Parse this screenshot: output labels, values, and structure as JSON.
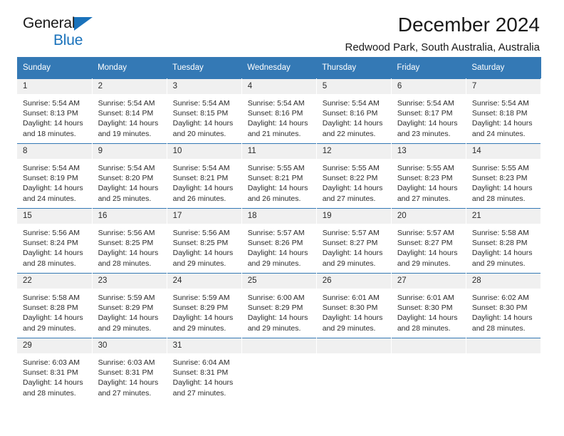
{
  "brand": {
    "word1": "General",
    "word2": "Blue",
    "triangle_color": "#1a72bb",
    "text_color": "#1a1a1a"
  },
  "header": {
    "title": "December 2024",
    "subtitle": "Redwood Park, South Australia, Australia"
  },
  "theme": {
    "header_blue": "#3479b5",
    "daynum_band": "#f0f0f0",
    "text": "#2b2b2b"
  },
  "weekday_headers": [
    "Sunday",
    "Monday",
    "Tuesday",
    "Wednesday",
    "Thursday",
    "Friday",
    "Saturday"
  ],
  "weeks": [
    [
      {
        "day": "1",
        "sunrise": "Sunrise: 5:54 AM",
        "sunset": "Sunset: 8:13 PM",
        "daylight_1": "Daylight: 14 hours",
        "daylight_2": "and 18 minutes."
      },
      {
        "day": "2",
        "sunrise": "Sunrise: 5:54 AM",
        "sunset": "Sunset: 8:14 PM",
        "daylight_1": "Daylight: 14 hours",
        "daylight_2": "and 19 minutes."
      },
      {
        "day": "3",
        "sunrise": "Sunrise: 5:54 AM",
        "sunset": "Sunset: 8:15 PM",
        "daylight_1": "Daylight: 14 hours",
        "daylight_2": "and 20 minutes."
      },
      {
        "day": "4",
        "sunrise": "Sunrise: 5:54 AM",
        "sunset": "Sunset: 8:16 PM",
        "daylight_1": "Daylight: 14 hours",
        "daylight_2": "and 21 minutes."
      },
      {
        "day": "5",
        "sunrise": "Sunrise: 5:54 AM",
        "sunset": "Sunset: 8:16 PM",
        "daylight_1": "Daylight: 14 hours",
        "daylight_2": "and 22 minutes."
      },
      {
        "day": "6",
        "sunrise": "Sunrise: 5:54 AM",
        "sunset": "Sunset: 8:17 PM",
        "daylight_1": "Daylight: 14 hours",
        "daylight_2": "and 23 minutes."
      },
      {
        "day": "7",
        "sunrise": "Sunrise: 5:54 AM",
        "sunset": "Sunset: 8:18 PM",
        "daylight_1": "Daylight: 14 hours",
        "daylight_2": "and 24 minutes."
      }
    ],
    [
      {
        "day": "8",
        "sunrise": "Sunrise: 5:54 AM",
        "sunset": "Sunset: 8:19 PM",
        "daylight_1": "Daylight: 14 hours",
        "daylight_2": "and 24 minutes."
      },
      {
        "day": "9",
        "sunrise": "Sunrise: 5:54 AM",
        "sunset": "Sunset: 8:20 PM",
        "daylight_1": "Daylight: 14 hours",
        "daylight_2": "and 25 minutes."
      },
      {
        "day": "10",
        "sunrise": "Sunrise: 5:54 AM",
        "sunset": "Sunset: 8:21 PM",
        "daylight_1": "Daylight: 14 hours",
        "daylight_2": "and 26 minutes."
      },
      {
        "day": "11",
        "sunrise": "Sunrise: 5:55 AM",
        "sunset": "Sunset: 8:21 PM",
        "daylight_1": "Daylight: 14 hours",
        "daylight_2": "and 26 minutes."
      },
      {
        "day": "12",
        "sunrise": "Sunrise: 5:55 AM",
        "sunset": "Sunset: 8:22 PM",
        "daylight_1": "Daylight: 14 hours",
        "daylight_2": "and 27 minutes."
      },
      {
        "day": "13",
        "sunrise": "Sunrise: 5:55 AM",
        "sunset": "Sunset: 8:23 PM",
        "daylight_1": "Daylight: 14 hours",
        "daylight_2": "and 27 minutes."
      },
      {
        "day": "14",
        "sunrise": "Sunrise: 5:55 AM",
        "sunset": "Sunset: 8:23 PM",
        "daylight_1": "Daylight: 14 hours",
        "daylight_2": "and 28 minutes."
      }
    ],
    [
      {
        "day": "15",
        "sunrise": "Sunrise: 5:56 AM",
        "sunset": "Sunset: 8:24 PM",
        "daylight_1": "Daylight: 14 hours",
        "daylight_2": "and 28 minutes."
      },
      {
        "day": "16",
        "sunrise": "Sunrise: 5:56 AM",
        "sunset": "Sunset: 8:25 PM",
        "daylight_1": "Daylight: 14 hours",
        "daylight_2": "and 28 minutes."
      },
      {
        "day": "17",
        "sunrise": "Sunrise: 5:56 AM",
        "sunset": "Sunset: 8:25 PM",
        "daylight_1": "Daylight: 14 hours",
        "daylight_2": "and 29 minutes."
      },
      {
        "day": "18",
        "sunrise": "Sunrise: 5:57 AM",
        "sunset": "Sunset: 8:26 PM",
        "daylight_1": "Daylight: 14 hours",
        "daylight_2": "and 29 minutes."
      },
      {
        "day": "19",
        "sunrise": "Sunrise: 5:57 AM",
        "sunset": "Sunset: 8:27 PM",
        "daylight_1": "Daylight: 14 hours",
        "daylight_2": "and 29 minutes."
      },
      {
        "day": "20",
        "sunrise": "Sunrise: 5:57 AM",
        "sunset": "Sunset: 8:27 PM",
        "daylight_1": "Daylight: 14 hours",
        "daylight_2": "and 29 minutes."
      },
      {
        "day": "21",
        "sunrise": "Sunrise: 5:58 AM",
        "sunset": "Sunset: 8:28 PM",
        "daylight_1": "Daylight: 14 hours",
        "daylight_2": "and 29 minutes."
      }
    ],
    [
      {
        "day": "22",
        "sunrise": "Sunrise: 5:58 AM",
        "sunset": "Sunset: 8:28 PM",
        "daylight_1": "Daylight: 14 hours",
        "daylight_2": "and 29 minutes."
      },
      {
        "day": "23",
        "sunrise": "Sunrise: 5:59 AM",
        "sunset": "Sunset: 8:29 PM",
        "daylight_1": "Daylight: 14 hours",
        "daylight_2": "and 29 minutes."
      },
      {
        "day": "24",
        "sunrise": "Sunrise: 5:59 AM",
        "sunset": "Sunset: 8:29 PM",
        "daylight_1": "Daylight: 14 hours",
        "daylight_2": "and 29 minutes."
      },
      {
        "day": "25",
        "sunrise": "Sunrise: 6:00 AM",
        "sunset": "Sunset: 8:29 PM",
        "daylight_1": "Daylight: 14 hours",
        "daylight_2": "and 29 minutes."
      },
      {
        "day": "26",
        "sunrise": "Sunrise: 6:01 AM",
        "sunset": "Sunset: 8:30 PM",
        "daylight_1": "Daylight: 14 hours",
        "daylight_2": "and 29 minutes."
      },
      {
        "day": "27",
        "sunrise": "Sunrise: 6:01 AM",
        "sunset": "Sunset: 8:30 PM",
        "daylight_1": "Daylight: 14 hours",
        "daylight_2": "and 28 minutes."
      },
      {
        "day": "28",
        "sunrise": "Sunrise: 6:02 AM",
        "sunset": "Sunset: 8:30 PM",
        "daylight_1": "Daylight: 14 hours",
        "daylight_2": "and 28 minutes."
      }
    ],
    [
      {
        "day": "29",
        "sunrise": "Sunrise: 6:03 AM",
        "sunset": "Sunset: 8:31 PM",
        "daylight_1": "Daylight: 14 hours",
        "daylight_2": "and 28 minutes."
      },
      {
        "day": "30",
        "sunrise": "Sunrise: 6:03 AM",
        "sunset": "Sunset: 8:31 PM",
        "daylight_1": "Daylight: 14 hours",
        "daylight_2": "and 27 minutes."
      },
      {
        "day": "31",
        "sunrise": "Sunrise: 6:04 AM",
        "sunset": "Sunset: 8:31 PM",
        "daylight_1": "Daylight: 14 hours",
        "daylight_2": "and 27 minutes."
      },
      {
        "day": "",
        "sunrise": "",
        "sunset": "",
        "daylight_1": "",
        "daylight_2": ""
      },
      {
        "day": "",
        "sunrise": "",
        "sunset": "",
        "daylight_1": "",
        "daylight_2": ""
      },
      {
        "day": "",
        "sunrise": "",
        "sunset": "",
        "daylight_1": "",
        "daylight_2": ""
      },
      {
        "day": "",
        "sunrise": "",
        "sunset": "",
        "daylight_1": "",
        "daylight_2": ""
      }
    ]
  ]
}
